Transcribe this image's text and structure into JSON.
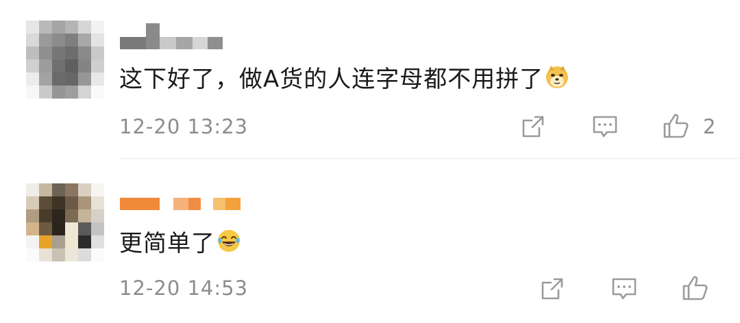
{
  "comments": [
    {
      "text": "这下好了，做A货的人连字母都不用拼了",
      "emoji": "doge-emoji",
      "time": "12-20 13:23",
      "likes": "2"
    },
    {
      "text": "更简单了",
      "emoji": "laughing-tears-emoji",
      "time": "12-20 14:53",
      "likes": ""
    }
  ],
  "icons": {
    "share": "share-icon",
    "reply": "comment-icon",
    "like": "thumbs-up-icon"
  },
  "colors": {
    "text": "#1a1a1a",
    "meta": "#8c8c8c",
    "icon": "#9a9a9a"
  }
}
